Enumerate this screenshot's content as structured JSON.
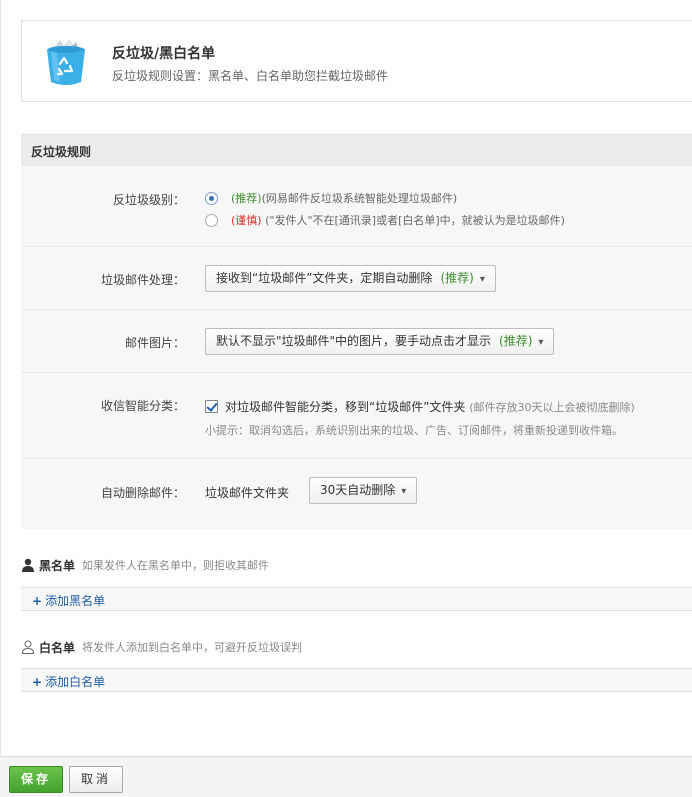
{
  "header": {
    "title": "反垃圾/黑白名单",
    "subtitle": "反垃圾规则设置：黑名单、白名单助您拦截垃圾邮件",
    "icon": "recycle-bin-icon"
  },
  "rules_section": {
    "title": "反垃圾规则",
    "level": {
      "label": "反垃圾级别：",
      "options": [
        {
          "tag": "(推荐)",
          "text": "(网易邮件反垃圾系统智能处理垃圾邮件)",
          "checked": true
        },
        {
          "tag": "(谨慎)",
          "text": " (\"发件人\"不在[通讯录]或者[白名单]中，就被认为是垃圾邮件)",
          "checked": false
        }
      ]
    },
    "spam_handling": {
      "label": "垃圾邮件处理：",
      "selected": "接收到“垃圾邮件”文件夹，定期自动删除",
      "tag": "(推荐)"
    },
    "spam_images": {
      "label": "邮件图片：",
      "selected": "默认不显示\"垃圾邮件\"中的图片，要手动点击才显示",
      "tag": "(推荐)"
    },
    "smart_classify": {
      "label": "收信智能分类：",
      "checked": true,
      "text": "对垃圾邮件智能分类，移到“垃圾邮件”文件夹",
      "note": "(邮件存放30天以上会被彻底删除)",
      "tip": "小提示：取消勾选后，系统识别出来的垃圾、广告、订阅邮件，将重新投递到收件箱。"
    },
    "auto_delete": {
      "label": "自动删除邮件：",
      "folder": "垃圾邮件文件夹",
      "selected": "30天自动删除"
    }
  },
  "blacklist": {
    "title": "黑名单",
    "desc": "如果发件人在黑名单中，则拒收其邮件",
    "add_label": "添加黑名单"
  },
  "whitelist": {
    "title": "白名单",
    "desc": "将发件人添加到白名单中，可避开反垃圾误判",
    "add_label": "添加白名单"
  },
  "footer": {
    "save_label": "保存",
    "cancel_label": "取消"
  },
  "colors": {
    "accent_green": "#45a22f",
    "link_blue": "#1d5fa8",
    "tag_green": "#3e8f2e",
    "tag_red": "#d9302c"
  }
}
